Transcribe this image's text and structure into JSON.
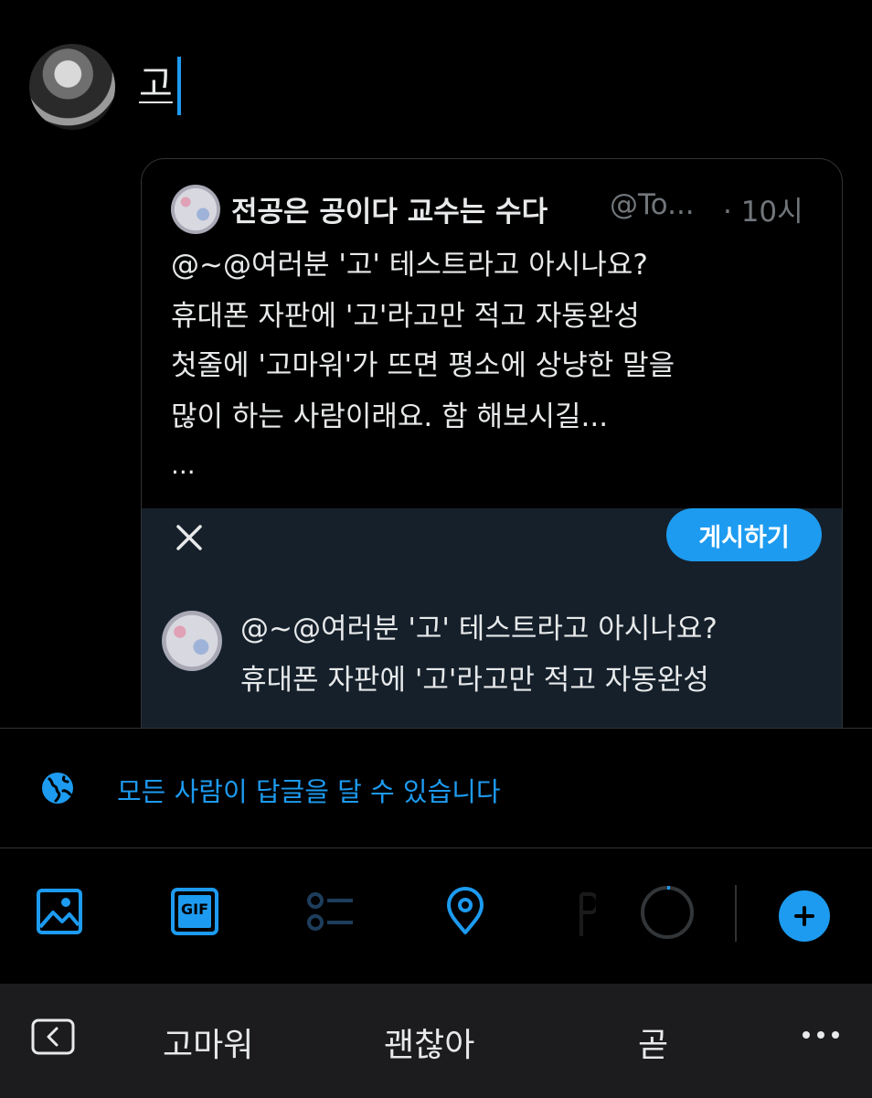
{
  "composer": {
    "text": "고"
  },
  "quote": {
    "author": "전공은 공이다 교수는 수다",
    "handle": "@To...",
    "time": "· 10시",
    "lines": [
      "@~@여러분 '고' 테스트라고 아시나요?",
      "휴대폰 자판에 '고'라고만 적고 자동완성",
      "첫줄에 '고마워'가 뜨면 평소에 상냥한 말을",
      "많이 하는 사람이래요. 함 해보시길..."
    ],
    "ellipsis": "..."
  },
  "overlay": {
    "post_label": "게시하기",
    "lines": [
      "@~@여러분 '고' 테스트라고 아시나요?",
      "휴대폰 자판에 '고'라고만 적고 자동완성"
    ]
  },
  "reply_setting": {
    "label": "모든 사람이 답글을 달 수 있습니다"
  },
  "toolbar": {
    "icons": [
      "image-icon",
      "gif-icon",
      "poll-icon",
      "location-icon",
      "progress-ring",
      "add-icon"
    ],
    "gif_label": "GIF"
  },
  "keyboard": {
    "suggestions": [
      "고마워",
      "괜찮아",
      "곧"
    ]
  },
  "colors": {
    "accent": "#1d9bf0",
    "background": "#000000",
    "overlay": "#15202b",
    "keyboard_bar": "#1c1c1e"
  }
}
